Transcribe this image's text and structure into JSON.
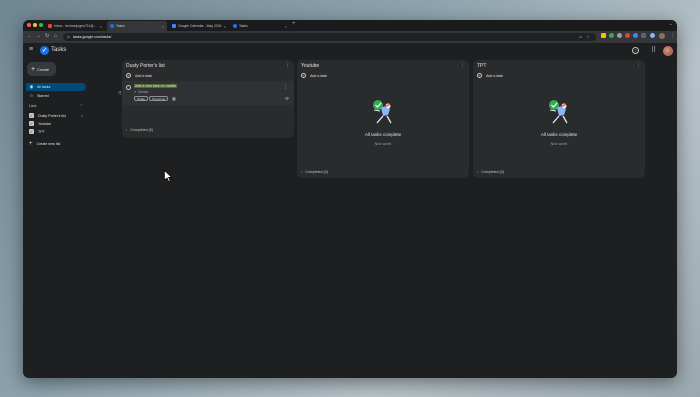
{
  "browser": {
    "tabs": [
      {
        "title": "Inbox - techmojogeo711@...",
        "color": "#ea4335",
        "active": false
      },
      {
        "title": "Tasks",
        "color": "#1a73e8",
        "active": true
      },
      {
        "title": "Google Calendar - May 2024",
        "color": "#4285f4",
        "active": false
      },
      {
        "title": "Tasks",
        "color": "#1a73e8",
        "active": false
      }
    ],
    "url": "tasks.google.com/tasks/"
  },
  "app": {
    "title": "Tasks",
    "create_label": "Create",
    "nav": [
      {
        "label": "All tasks",
        "icon": "check-circle-icon",
        "active": true
      },
      {
        "label": "Starred",
        "icon": "star-icon",
        "active": false
      }
    ],
    "lists_header": "Lists",
    "lists": [
      {
        "label": "Dusty Porter's list",
        "count": "1"
      },
      {
        "label": "Youtube",
        "count": ""
      },
      {
        "label": "TPT",
        "count": ""
      }
    ],
    "create_new_list": "Create new list"
  },
  "columns": [
    {
      "title": "Dusty Porter's list",
      "add_task": "Add a task",
      "task": {
        "title": "Add a new task on mobile",
        "details": "Details",
        "chip_today": "Today",
        "chip_tomorrow": "Tomorrow"
      },
      "completed": "Completed (0)"
    },
    {
      "title": "Youtube",
      "add_task": "Add a task",
      "empty_title": "All tasks complete",
      "empty_sub": "Nice work!",
      "completed": "Completed (0)"
    },
    {
      "title": "TPT",
      "add_task": "Add a task",
      "empty_title": "All tasks complete",
      "empty_sub": "Nice work!",
      "completed": "Completed (0)"
    }
  ]
}
